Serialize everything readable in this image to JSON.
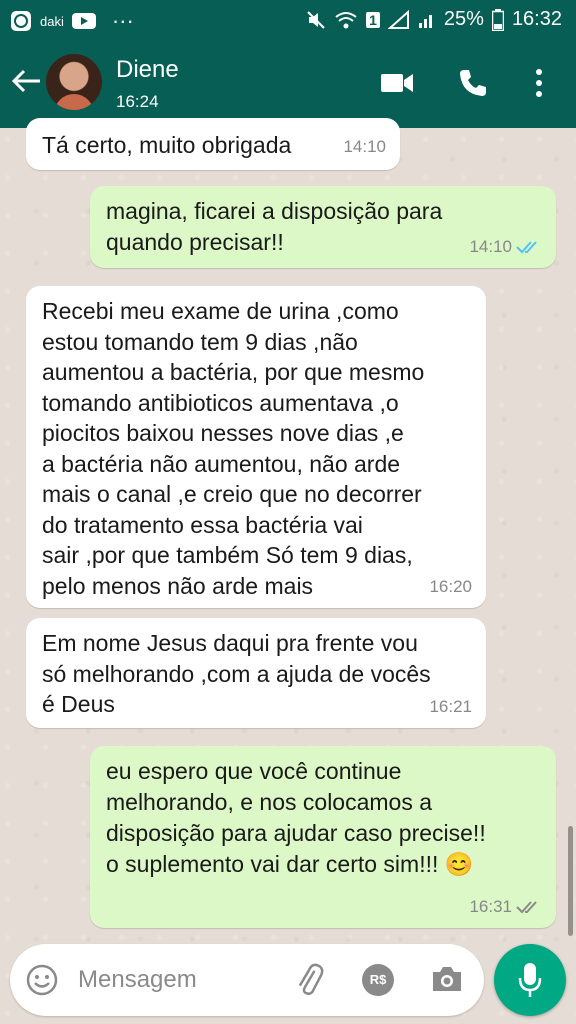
{
  "status_bar": {
    "app_label": "daki",
    "dots": "···",
    "sim": "1",
    "battery": "25%",
    "time": "16:32"
  },
  "header": {
    "contact_name": "Diene",
    "contact_status": "16:24"
  },
  "messages": [
    {
      "direction": "incoming",
      "text": "Tá certo, muito obrigada",
      "time": "14:10"
    },
    {
      "direction": "outgoing",
      "text": "magina, ficarei a disposição para\nquando precisar!!",
      "time": "14:10",
      "ticks": "read"
    },
    {
      "direction": "incoming",
      "text": "Recebi meu exame de urina ,como\nestou tomando tem 9 dias ,não\naumentou a bactéria, por que mesmo\ntomando antibioticos aumentava ,o\npiocitos baixou nesses nove dias ,e\na bactéria não aumentou, não arde\nmais o canal ,e creio que no decorrer\ndo tratamento essa bactéria vai\nsair ,por que também Só tem 9 dias,\npelo menos não arde mais",
      "time": "16:20"
    },
    {
      "direction": "incoming",
      "text": "Em nome Jesus daqui pra frente vou\nsó melhorando ,com a ajuda de vocês\né Deus",
      "time": "16:21"
    },
    {
      "direction": "outgoing",
      "text": "eu espero que você continue\nmelhorando, e nos colocamos a\ndisposição para ajudar caso precise!!\no suplemento vai dar certo sim!!! 😊",
      "time": "16:31",
      "ticks": "delivered"
    }
  ],
  "input": {
    "placeholder": "Mensagem",
    "rs_label": "R$"
  },
  "colors": {
    "header": "#075e54",
    "outgoing_bubble": "#dcf8c6",
    "incoming_bubble": "#ffffff",
    "read_ticks": "#4fc3f7",
    "mic_button": "#00a884"
  }
}
